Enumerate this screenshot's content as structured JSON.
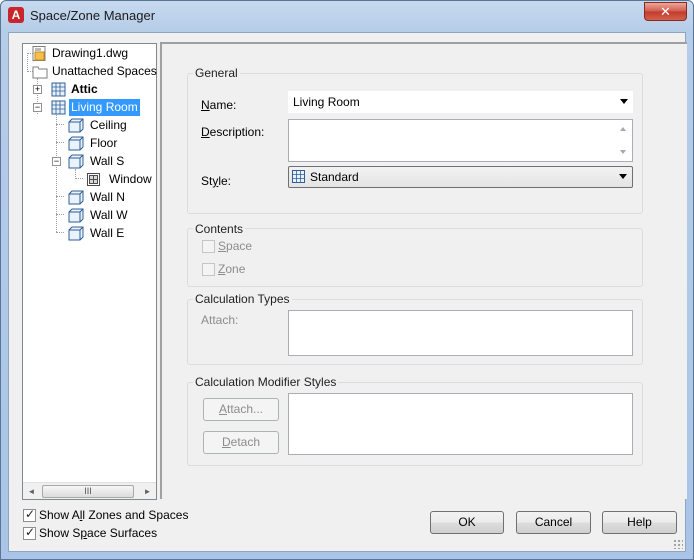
{
  "window": {
    "title": "Space/Zone Manager",
    "app_icon_letter": "A",
    "close_glyph": "✕"
  },
  "tree": {
    "items": [
      {
        "label": "Drawing1.dwg",
        "icon": "drawing-file-icon"
      },
      {
        "label": "Unattached Spaces",
        "icon": "folder-icon"
      },
      {
        "label": "Attic",
        "icon": "space-icon",
        "expander": "+"
      },
      {
        "label": "Living Room",
        "icon": "space-icon",
        "expander": "−",
        "selected": true
      },
      {
        "label": "Ceiling",
        "icon": "surface-icon"
      },
      {
        "label": "Floor",
        "icon": "surface-icon"
      },
      {
        "label": "Wall S",
        "icon": "surface-icon",
        "expander": "−"
      },
      {
        "label": "Window",
        "icon": "opening-icon"
      },
      {
        "label": "Wall N",
        "icon": "surface-icon"
      },
      {
        "label": "Wall W",
        "icon": "surface-icon"
      },
      {
        "label": "Wall E",
        "icon": "surface-icon"
      }
    ],
    "scroll_left": "◄",
    "scroll_right": "►",
    "scroll_thumb": "III"
  },
  "general": {
    "title": "General",
    "name_label_ul": "N",
    "name_label_rest": "ame:",
    "name_value": "Living Room",
    "description_label_ul": "D",
    "description_label_rest": "escription:",
    "description_value": "",
    "style_label_pre": "St",
    "style_label_ul": "y",
    "style_label_rest": "le:",
    "style_value": "Standard"
  },
  "contents": {
    "title": "Contents",
    "space_ul": "S",
    "space_rest": "pace",
    "zone_ul": "Z",
    "zone_rest": "one",
    "space_checked": false,
    "zone_checked": false
  },
  "calc_types": {
    "title": "Calculation Types",
    "attach_label": "Attach:"
  },
  "calc_modifiers": {
    "title": "Calculation Modifier Styles",
    "attach_button_ul": "A",
    "attach_button_rest": "ttach...",
    "detach_button_ul": "D",
    "detach_button_rest": "etach"
  },
  "footer": {
    "show_all_pre": "Show A",
    "show_all_ul": "l",
    "show_all_rest": "l Zones and Spaces",
    "show_all_checked": true,
    "show_surfaces_pre": "Show S",
    "show_surfaces_ul": "p",
    "show_surfaces_rest": "ace Surfaces",
    "show_surfaces_checked": true,
    "check_glyph": "✓",
    "ok_label": "OK",
    "cancel_label": "Cancel",
    "help_label": "Help"
  }
}
